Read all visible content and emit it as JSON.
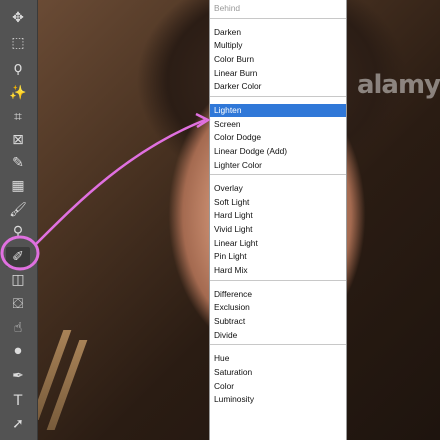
{
  "watermark": "alamy",
  "annotation_color": "#e070e0",
  "selection_color": "#3078d8",
  "toolbar": {
    "tools": [
      {
        "name": "move-tool",
        "icon": "move-icon",
        "glyph": "✥"
      },
      {
        "name": "marquee-tool",
        "icon": "marquee-icon",
        "glyph": "⬚"
      },
      {
        "name": "lasso-tool",
        "icon": "lasso-icon",
        "glyph": "ϙ"
      },
      {
        "name": "magic-wand-tool",
        "icon": "magic-wand-icon",
        "glyph": "✨"
      },
      {
        "name": "crop-tool",
        "icon": "crop-icon",
        "glyph": "⌗"
      },
      {
        "name": "frame-tool",
        "icon": "frame-icon",
        "glyph": "⊠"
      },
      {
        "name": "eyedropper-tool",
        "icon": "eyedropper-icon",
        "glyph": "✎"
      },
      {
        "name": "healing-brush-tool",
        "icon": "bandage-icon",
        "glyph": "▦"
      },
      {
        "name": "brush-tool",
        "icon": "brush-icon",
        "glyph": "🖌"
      },
      {
        "name": "clone-stamp-tool",
        "icon": "stamp-icon",
        "glyph": "⚲"
      },
      {
        "name": "history-brush-tool",
        "icon": "history-brush-icon",
        "glyph": "✐"
      },
      {
        "name": "eraser-tool",
        "icon": "eraser-icon",
        "glyph": "◫"
      },
      {
        "name": "paint-bucket-tool",
        "icon": "bucket-icon",
        "glyph": "⛋"
      },
      {
        "name": "smudge-tool",
        "icon": "smudge-icon",
        "glyph": "☝"
      },
      {
        "name": "dodge-tool",
        "icon": "dodge-icon",
        "glyph": "⚫"
      },
      {
        "name": "pen-tool",
        "icon": "pen-icon",
        "glyph": "✒"
      },
      {
        "name": "type-tool",
        "icon": "type-icon",
        "glyph": "T"
      },
      {
        "name": "path-selection-tool",
        "icon": "arrow-cursor-icon",
        "glyph": "➚"
      }
    ]
  },
  "blend_menu": {
    "groups": [
      [
        "Behind"
      ],
      [
        "Darken",
        "Multiply",
        "Color Burn",
        "Linear Burn",
        "Darker Color"
      ],
      [
        "Lighten",
        "Screen",
        "Color Dodge",
        "Linear Dodge (Add)",
        "Lighter Color"
      ],
      [
        "Overlay",
        "Soft Light",
        "Hard Light",
        "Vivid Light",
        "Linear Light",
        "Pin Light",
        "Hard Mix"
      ],
      [
        "Difference",
        "Exclusion",
        "Subtract",
        "Divide"
      ],
      [
        "Hue",
        "Saturation",
        "Color",
        "Luminosity"
      ]
    ],
    "disabled": [
      "Behind"
    ],
    "selected": "Lighten"
  }
}
